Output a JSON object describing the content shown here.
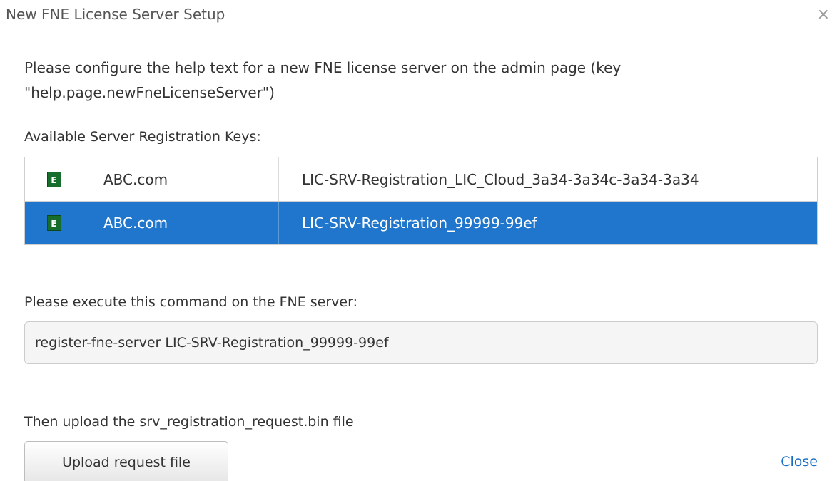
{
  "dialog": {
    "title": "New FNE License Server Setup",
    "close_glyph": "×"
  },
  "help": {
    "text": "Please configure the help text for a new FNE license server on the admin page (key \"help.page.newFneLicenseServer\")"
  },
  "keys": {
    "label": "Available Server Registration Keys:",
    "icon_letter": "E",
    "icon_name": "fne-server-icon",
    "rows": [
      {
        "domain": "ABC.com",
        "key": "LIC-SRV-Registration_LIC_Cloud_3a34-3a34c-3a34-3a34",
        "selected": false
      },
      {
        "domain": "ABC.com",
        "key": "LIC-SRV-Registration_99999-99ef",
        "selected": true
      }
    ]
  },
  "command": {
    "label": "Please execute this command on the FNE server:",
    "value": "register-fne-server LIC-SRV-Registration_99999-99ef"
  },
  "upload": {
    "label": "Then upload the srv_registration_request.bin file",
    "button_label": "Upload request file"
  },
  "footer": {
    "close_label": "Close"
  },
  "colors": {
    "selection": "#1f76cc",
    "icon_green": "#176e2c",
    "link": "#1a6dc4"
  }
}
